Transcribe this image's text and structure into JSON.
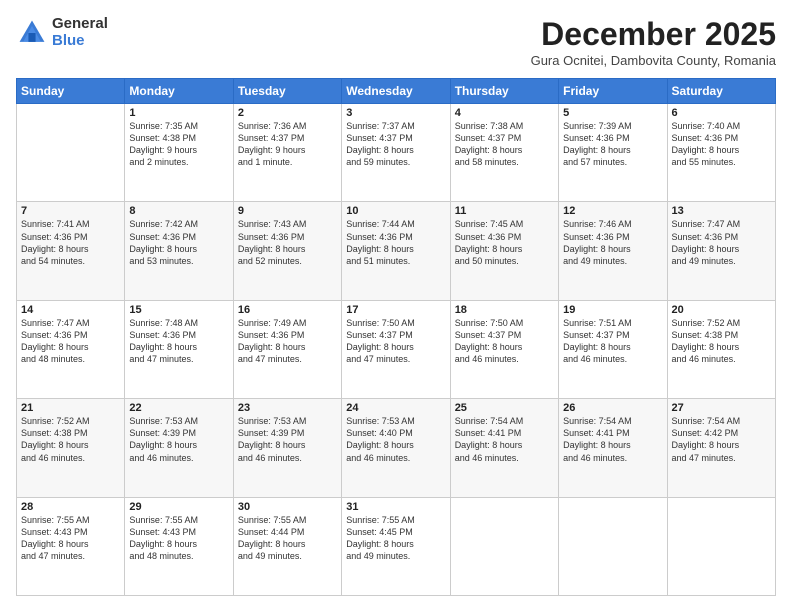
{
  "logo": {
    "general": "General",
    "blue": "Blue"
  },
  "title": {
    "month_year": "December 2025",
    "location": "Gura Ocnitei, Dambovita County, Romania"
  },
  "weekdays": [
    "Sunday",
    "Monday",
    "Tuesday",
    "Wednesday",
    "Thursday",
    "Friday",
    "Saturday"
  ],
  "weeks": [
    [
      {
        "day": "",
        "sunrise": "",
        "sunset": "",
        "daylight": ""
      },
      {
        "day": "1",
        "sunrise": "Sunrise: 7:35 AM",
        "sunset": "Sunset: 4:38 PM",
        "daylight": "Daylight: 9 hours and 2 minutes."
      },
      {
        "day": "2",
        "sunrise": "Sunrise: 7:36 AM",
        "sunset": "Sunset: 4:37 PM",
        "daylight": "Daylight: 9 hours and 1 minute."
      },
      {
        "day": "3",
        "sunrise": "Sunrise: 7:37 AM",
        "sunset": "Sunset: 4:37 PM",
        "daylight": "Daylight: 8 hours and 59 minutes."
      },
      {
        "day": "4",
        "sunrise": "Sunrise: 7:38 AM",
        "sunset": "Sunset: 4:37 PM",
        "daylight": "Daylight: 8 hours and 58 minutes."
      },
      {
        "day": "5",
        "sunrise": "Sunrise: 7:39 AM",
        "sunset": "Sunset: 4:36 PM",
        "daylight": "Daylight: 8 hours and 57 minutes."
      },
      {
        "day": "6",
        "sunrise": "Sunrise: 7:40 AM",
        "sunset": "Sunset: 4:36 PM",
        "daylight": "Daylight: 8 hours and 55 minutes."
      }
    ],
    [
      {
        "day": "7",
        "sunrise": "Sunrise: 7:41 AM",
        "sunset": "Sunset: 4:36 PM",
        "daylight": "Daylight: 8 hours and 54 minutes."
      },
      {
        "day": "8",
        "sunrise": "Sunrise: 7:42 AM",
        "sunset": "Sunset: 4:36 PM",
        "daylight": "Daylight: 8 hours and 53 minutes."
      },
      {
        "day": "9",
        "sunrise": "Sunrise: 7:43 AM",
        "sunset": "Sunset: 4:36 PM",
        "daylight": "Daylight: 8 hours and 52 minutes."
      },
      {
        "day": "10",
        "sunrise": "Sunrise: 7:44 AM",
        "sunset": "Sunset: 4:36 PM",
        "daylight": "Daylight: 8 hours and 51 minutes."
      },
      {
        "day": "11",
        "sunrise": "Sunrise: 7:45 AM",
        "sunset": "Sunset: 4:36 PM",
        "daylight": "Daylight: 8 hours and 50 minutes."
      },
      {
        "day": "12",
        "sunrise": "Sunrise: 7:46 AM",
        "sunset": "Sunset: 4:36 PM",
        "daylight": "Daylight: 8 hours and 49 minutes."
      },
      {
        "day": "13",
        "sunrise": "Sunrise: 7:47 AM",
        "sunset": "Sunset: 4:36 PM",
        "daylight": "Daylight: 8 hours and 49 minutes."
      }
    ],
    [
      {
        "day": "14",
        "sunrise": "Sunrise: 7:47 AM",
        "sunset": "Sunset: 4:36 PM",
        "daylight": "Daylight: 8 hours and 48 minutes."
      },
      {
        "day": "15",
        "sunrise": "Sunrise: 7:48 AM",
        "sunset": "Sunset: 4:36 PM",
        "daylight": "Daylight: 8 hours and 47 minutes."
      },
      {
        "day": "16",
        "sunrise": "Sunrise: 7:49 AM",
        "sunset": "Sunset: 4:36 PM",
        "daylight": "Daylight: 8 hours and 47 minutes."
      },
      {
        "day": "17",
        "sunrise": "Sunrise: 7:50 AM",
        "sunset": "Sunset: 4:37 PM",
        "daylight": "Daylight: 8 hours and 47 minutes."
      },
      {
        "day": "18",
        "sunrise": "Sunrise: 7:50 AM",
        "sunset": "Sunset: 4:37 PM",
        "daylight": "Daylight: 8 hours and 46 minutes."
      },
      {
        "day": "19",
        "sunrise": "Sunrise: 7:51 AM",
        "sunset": "Sunset: 4:37 PM",
        "daylight": "Daylight: 8 hours and 46 minutes."
      },
      {
        "day": "20",
        "sunrise": "Sunrise: 7:52 AM",
        "sunset": "Sunset: 4:38 PM",
        "daylight": "Daylight: 8 hours and 46 minutes."
      }
    ],
    [
      {
        "day": "21",
        "sunrise": "Sunrise: 7:52 AM",
        "sunset": "Sunset: 4:38 PM",
        "daylight": "Daylight: 8 hours and 46 minutes."
      },
      {
        "day": "22",
        "sunrise": "Sunrise: 7:53 AM",
        "sunset": "Sunset: 4:39 PM",
        "daylight": "Daylight: 8 hours and 46 minutes."
      },
      {
        "day": "23",
        "sunrise": "Sunrise: 7:53 AM",
        "sunset": "Sunset: 4:39 PM",
        "daylight": "Daylight: 8 hours and 46 minutes."
      },
      {
        "day": "24",
        "sunrise": "Sunrise: 7:53 AM",
        "sunset": "Sunset: 4:40 PM",
        "daylight": "Daylight: 8 hours and 46 minutes."
      },
      {
        "day": "25",
        "sunrise": "Sunrise: 7:54 AM",
        "sunset": "Sunset: 4:41 PM",
        "daylight": "Daylight: 8 hours and 46 minutes."
      },
      {
        "day": "26",
        "sunrise": "Sunrise: 7:54 AM",
        "sunset": "Sunset: 4:41 PM",
        "daylight": "Daylight: 8 hours and 46 minutes."
      },
      {
        "day": "27",
        "sunrise": "Sunrise: 7:54 AM",
        "sunset": "Sunset: 4:42 PM",
        "daylight": "Daylight: 8 hours and 47 minutes."
      }
    ],
    [
      {
        "day": "28",
        "sunrise": "Sunrise: 7:55 AM",
        "sunset": "Sunset: 4:43 PM",
        "daylight": "Daylight: 8 hours and 47 minutes."
      },
      {
        "day": "29",
        "sunrise": "Sunrise: 7:55 AM",
        "sunset": "Sunset: 4:43 PM",
        "daylight": "Daylight: 8 hours and 48 minutes."
      },
      {
        "day": "30",
        "sunrise": "Sunrise: 7:55 AM",
        "sunset": "Sunset: 4:44 PM",
        "daylight": "Daylight: 8 hours and 49 minutes."
      },
      {
        "day": "31",
        "sunrise": "Sunrise: 7:55 AM",
        "sunset": "Sunset: 4:45 PM",
        "daylight": "Daylight: 8 hours and 49 minutes."
      },
      {
        "day": "",
        "sunrise": "",
        "sunset": "",
        "daylight": ""
      },
      {
        "day": "",
        "sunrise": "",
        "sunset": "",
        "daylight": ""
      },
      {
        "day": "",
        "sunrise": "",
        "sunset": "",
        "daylight": ""
      }
    ]
  ]
}
